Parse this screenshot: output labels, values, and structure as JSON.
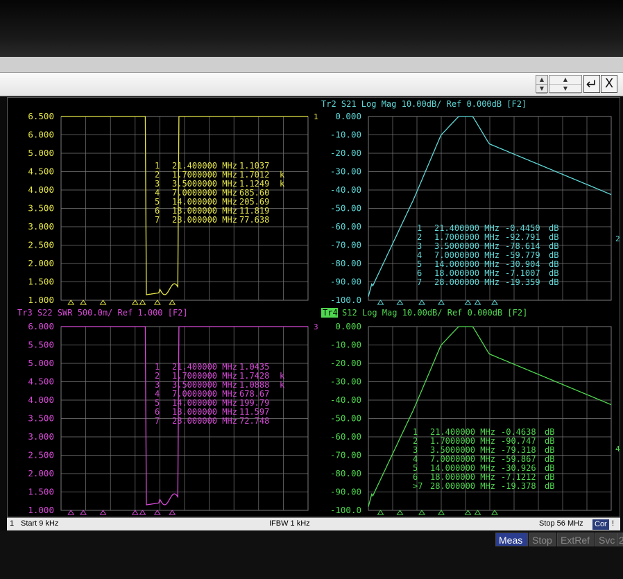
{
  "window": {
    "close_symbol": "X",
    "enter_symbol": "↵",
    "spin_up": "▲",
    "spin_down": "▼"
  },
  "panels": [
    {
      "id": "tr1",
      "trace_color": "#e6e64a",
      "header": "",
      "channel_marker": "1",
      "y_labels": [
        "6.500",
        "6.000",
        "5.000",
        "4.500",
        "4.000",
        "3.500",
        "3.000",
        "2.500",
        "2.000",
        "1.500",
        "1.000"
      ],
      "markers": [
        {
          "n": "1",
          "freq": "21.400000 MHz",
          "value": "1.1037",
          "unit": ""
        },
        {
          "n": "2",
          "freq": "1.7000000 MHz",
          "value": "1.7012",
          "unit": "k"
        },
        {
          "n": "3",
          "freq": "3.5000000 MHz",
          "value": "1.1249",
          "unit": "k"
        },
        {
          "n": "4",
          "freq": "7.0000000 MHz",
          "value": "685.60",
          "unit": ""
        },
        {
          "n": "5",
          "freq": "14.000000 MHz",
          "value": "205.69",
          "unit": ""
        },
        {
          "n": "6",
          "freq": "18.000000 MHz",
          "value": "11.819",
          "unit": ""
        },
        {
          "n": "7",
          "freq": "28.000000 MHz",
          "value": "77.638",
          "unit": ""
        }
      ]
    },
    {
      "id": "tr2",
      "trace_color": "#5fd8d8",
      "header": "Tr2  S21  Log Mag  10.00dB/  Ref  0.000dB  [F2]",
      "channel_marker": "2",
      "y_labels": [
        "0.000",
        "-10.00",
        "-20.00",
        "-30.00",
        "-40.00",
        "-50.00",
        "-60.00",
        "-70.00",
        "-80.00",
        "-90.00",
        "-100.0"
      ],
      "markers": [
        {
          "n": "1",
          "freq": "21.400000 MHz",
          "value": "-0.4450",
          "unit": "dB"
        },
        {
          "n": "2",
          "freq": "1.7000000 MHz",
          "value": "-92.791",
          "unit": "dB"
        },
        {
          "n": "3",
          "freq": "3.5000000 MHz",
          "value": "-78.614",
          "unit": "dB"
        },
        {
          "n": "4",
          "freq": "7.0000000 MHz",
          "value": "-59.779",
          "unit": "dB"
        },
        {
          "n": "5",
          "freq": "14.000000 MHz",
          "value": "-30.904",
          "unit": "dB"
        },
        {
          "n": "6",
          "freq": "18.000000 MHz",
          "value": "-7.1007",
          "unit": "dB"
        },
        {
          "n": "7",
          "freq": "28.000000 MHz",
          "value": "-19.359",
          "unit": "dB"
        }
      ]
    },
    {
      "id": "tr3",
      "trace_color": "#d64ad6",
      "header": "Tr3  S22  SWR  500.0m/  Ref  1.000  [F2]",
      "channel_marker": "3",
      "y_labels": [
        "6.000",
        "5.500",
        "5.000",
        "4.500",
        "4.000",
        "3.500",
        "3.000",
        "2.500",
        "2.000",
        "1.500",
        "1.000"
      ],
      "markers": [
        {
          "n": "1",
          "freq": "21.400000 MHz",
          "value": "1.0435",
          "unit": ""
        },
        {
          "n": "2",
          "freq": "1.7000000 MHz",
          "value": "1.7428",
          "unit": "k"
        },
        {
          "n": "3",
          "freq": "3.5000000 MHz",
          "value": "1.0888",
          "unit": "k"
        },
        {
          "n": "4",
          "freq": "7.0000000 MHz",
          "value": "678.67",
          "unit": ""
        },
        {
          "n": "5",
          "freq": "14.000000 MHz",
          "value": "199.79",
          "unit": ""
        },
        {
          "n": "6",
          "freq": "18.000000 MHz",
          "value": "11.597",
          "unit": ""
        },
        {
          "n": "7",
          "freq": "28.000000 MHz",
          "value": "72.748",
          "unit": ""
        }
      ]
    },
    {
      "id": "tr4",
      "trace_color": "#4fd84f",
      "header_tag": "Tr4",
      "header": "S12  Log Mag  10.00dB/  Ref  0.000dB  [F2]",
      "channel_marker": "4",
      "y_labels": [
        "0.000",
        "-10.00",
        "-20.00",
        "-30.00",
        "-40.00",
        "-50.00",
        "-60.00",
        "-70.00",
        "-80.00",
        "-90.00",
        "-100.0"
      ],
      "markers": [
        {
          "n": "1",
          "freq": "21.400000 MHz",
          "value": "-0.4638",
          "unit": "dB"
        },
        {
          "n": "2",
          "freq": "1.7000000 MHz",
          "value": "-90.747",
          "unit": "dB"
        },
        {
          "n": "3",
          "freq": "3.5000000 MHz",
          "value": "-79.318",
          "unit": "dB"
        },
        {
          "n": "4",
          "freq": "7.0000000 MHz",
          "value": "-59.867",
          "unit": "dB"
        },
        {
          "n": "5",
          "freq": "14.000000 MHz",
          "value": "-30.926",
          "unit": "dB"
        },
        {
          "n": "6",
          "freq": "18.000000 MHz",
          "value": "-7.1212",
          "unit": "dB"
        },
        {
          "n": ">7",
          "freq": "28.000000 MHz",
          "value": "-19.378",
          "unit": "dB"
        }
      ]
    }
  ],
  "status": {
    "channel": "1",
    "start": "Start 9 kHz",
    "ifbw": "IFBW 1 kHz",
    "stop": "Stop 56 MHz",
    "cor": "Cor",
    "flag": "!"
  },
  "softkeys": [
    {
      "label": "Meas",
      "active": true
    },
    {
      "label": "Stop",
      "active": false
    },
    {
      "label": "ExtRef",
      "active": false
    },
    {
      "label": "Svc",
      "active": false
    },
    {
      "label": "2",
      "active": false
    }
  ],
  "colors": {
    "grid": "#7a7a7a",
    "background": "#000000",
    "cursor": "#e6e64a"
  }
}
